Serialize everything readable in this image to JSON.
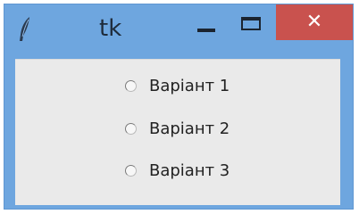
{
  "window": {
    "title": "tk",
    "controls": {
      "minimize": "minimize",
      "maximize": "maximize",
      "close_glyph": "✕"
    },
    "icon": "feather-icon"
  },
  "radio_group": {
    "options": [
      {
        "label": "Варіант 1",
        "selected": false
      },
      {
        "label": "Варіант 2",
        "selected": false
      },
      {
        "label": "Варіант 3",
        "selected": false
      }
    ]
  },
  "colors": {
    "title_bar": "#6ea6df",
    "close_button": "#c9524e",
    "client_background": "#eaeaea"
  }
}
